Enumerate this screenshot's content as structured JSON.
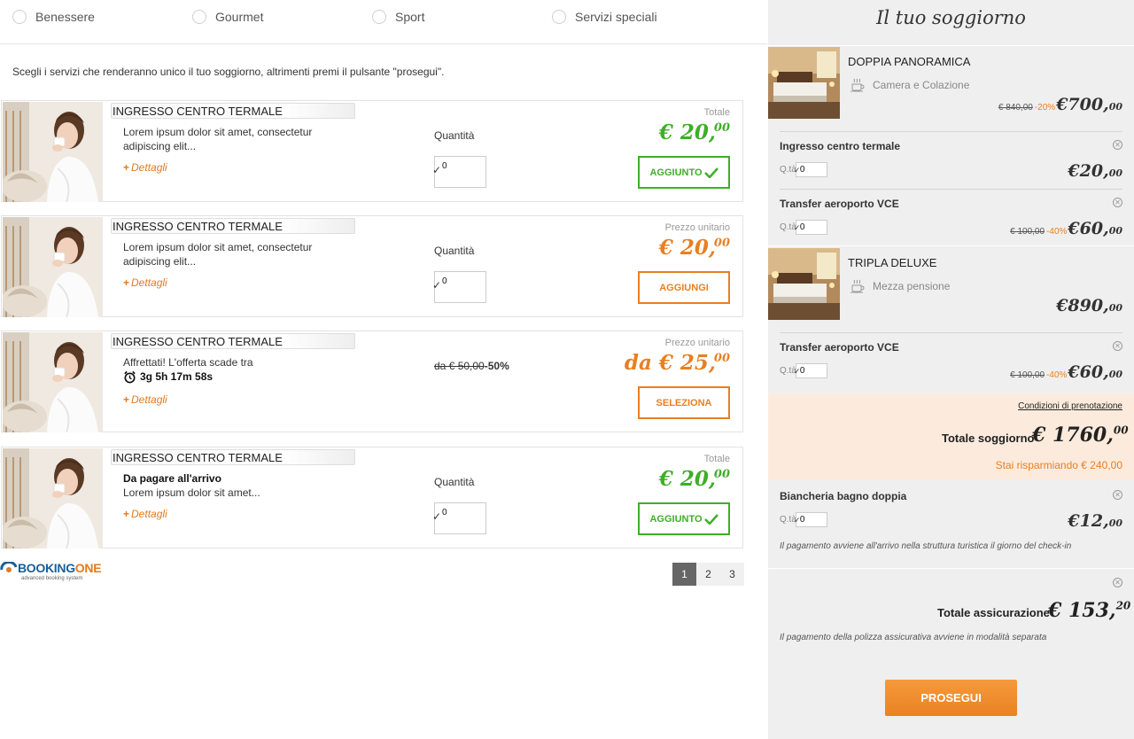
{
  "filters": [
    "Benessere",
    "Gourmet",
    "Sport",
    "Servizi speciali"
  ],
  "intro": "Scegli i servizi che renderanno unico il tuo soggiorno, altrimenti premi il pulsante \"prosegui\".",
  "cards": [
    {
      "title": "INGRESSO CENTRO TERMALE",
      "desc": "Lorem ipsum dolor sit amet, consectetur adipiscing elit...",
      "details": "Dettagli",
      "qty_label": "Quantità",
      "qty": "0",
      "price_type": "Totale",
      "price_main": "€ 20,",
      "price_dec": "00",
      "button": "AGGIUNTO"
    },
    {
      "title": "INGRESSO CENTRO TERMALE",
      "desc": "Lorem ipsum dolor sit amet, consectetur adipiscing elit...",
      "details": "Dettagli",
      "qty_label": "Quantità",
      "qty": "0",
      "price_type": "Prezzo unitario",
      "price_main": "€ 20,",
      "price_dec": "00",
      "button": "AGGIUNGI"
    },
    {
      "title": "INGRESSO CENTRO TERMALE",
      "desc": "Affrettati! L'offerta scade tra",
      "timer": "3g 5h 17m 58s",
      "details": "Dettagli",
      "old_price": "da € 50,00",
      "discount": "-50%",
      "price_type": "Prezzo unitario",
      "price_main": "da € 25,",
      "price_dec": "00",
      "button": "SELEZIONA"
    },
    {
      "title": "INGRESSO CENTRO TERMALE",
      "desc_bold": "Da pagare all'arrivo",
      "desc": "Lorem ipsum dolor sit amet...",
      "details": "Dettagli",
      "qty_label": "Quantità",
      "qty": "0",
      "price_type": "Totale",
      "price_main": "€ 20,",
      "price_dec": "00",
      "button": "AGGIUNTO"
    }
  ],
  "logo": {
    "name_a": "BOOKING",
    "name_b": "ONE",
    "tagline": "advanced booking system"
  },
  "pages": [
    "1",
    "2",
    "3"
  ],
  "current_page": "1",
  "summary": {
    "title": "Il tuo soggiorno",
    "rooms": [
      {
        "name": "DOPPIA PANORAMICA",
        "board": "Camera e Colazione",
        "old_price": "€ 840,00",
        "discount": "-20%",
        "price_main": "€700,",
        "price_dec": "00",
        "services": [
          {
            "name": "Ingresso centro termale",
            "qty_label": "Q.tà",
            "qty": "0",
            "old_price": "",
            "discount": "",
            "price_main": "€20,",
            "price_dec": "00"
          },
          {
            "name": "Transfer aeroporto VCE",
            "qty_label": "Q.tà",
            "qty": "0",
            "old_price": "€ 100,00",
            "discount": "-40%",
            "price_main": "€60,",
            "price_dec": "00"
          }
        ]
      },
      {
        "name": "TRIPLA DELUXE",
        "board": "Mezza pensione",
        "price_main": "€890,",
        "price_dec": "00",
        "services": [
          {
            "name": "Transfer aeroporto VCE",
            "qty_label": "Q.tà",
            "qty": "0",
            "old_price": "€ 100,00",
            "discount": "-40%",
            "price_main": "€60,",
            "price_dec": "00"
          }
        ]
      }
    ],
    "conditions": "Condizioni di prenotazione",
    "total_label": "Totale soggiorno",
    "total_main": "€ 1760,",
    "total_dec": "00",
    "saving": "Stai risparmiando € 240,00",
    "arrival_service": {
      "name": "Biancheria bagno doppia",
      "qty_label": "Q.tà",
      "qty": "0",
      "price_main": "€12,",
      "price_dec": "00",
      "note": "Il pagamento avviene all'arrivo nella struttura turistica il giorno del check-in"
    },
    "insurance": {
      "label": "Totale assicurazione",
      "price_main": "€ 153,",
      "price_dec": "20",
      "note": "Il pagamento della polizza assicurativa avviene in modalità separata"
    },
    "proceed": "PROSEGUI"
  },
  "colors": {
    "green": "#3fae29",
    "orange": "#e97f20",
    "panel": "#efefef",
    "total_bg": "#fcebdd"
  }
}
